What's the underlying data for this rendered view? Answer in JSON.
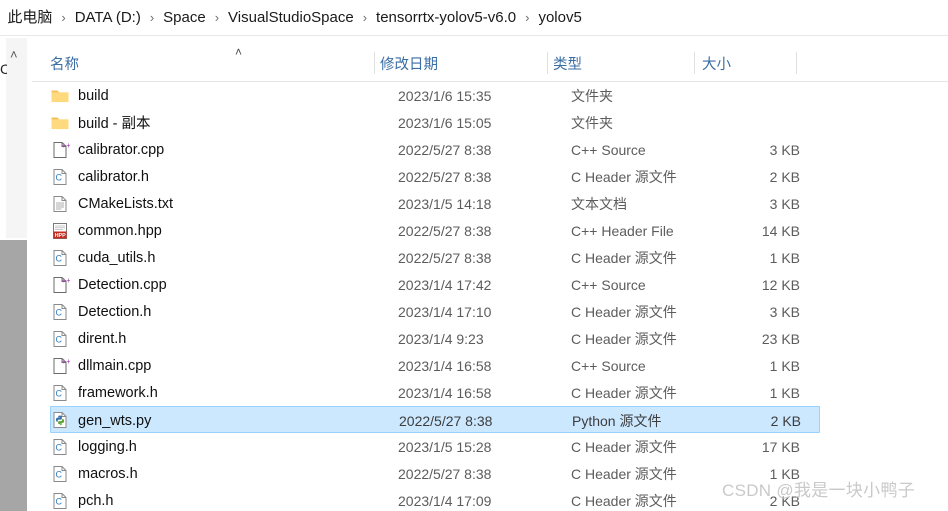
{
  "breadcrumb": {
    "lead_separator": "›",
    "separator": "›",
    "items": [
      {
        "label": "此电脑"
      },
      {
        "label": "DATA (D:)"
      },
      {
        "label": "Space"
      },
      {
        "label": "VisualStudioSpace"
      },
      {
        "label": "tensorrtx-yolov5-v6.0"
      },
      {
        "label": "yolov5"
      }
    ]
  },
  "nav_pane": {
    "collapse_caret": "˄",
    "clipped_label": "C"
  },
  "columns": {
    "sort_indicator": "˄",
    "headers": [
      {
        "label": "名称"
      },
      {
        "label": "修改日期"
      },
      {
        "label": "类型"
      },
      {
        "label": "大小"
      }
    ]
  },
  "files": [
    {
      "name": "build",
      "date": "2023/1/6 15:35",
      "type": "文件夹",
      "size": "",
      "icon": "folder-icon",
      "selected": false
    },
    {
      "name": "build - 副本",
      "date": "2023/1/6 15:05",
      "type": "文件夹",
      "size": "",
      "icon": "folder-icon",
      "selected": false
    },
    {
      "name": "calibrator.cpp",
      "date": "2022/5/27 8:38",
      "type": "C++ Source",
      "size": "3 KB",
      "icon": "cpp-source-icon",
      "selected": false
    },
    {
      "name": "calibrator.h",
      "date": "2022/5/27 8:38",
      "type": "C Header 源文件",
      "size": "2 KB",
      "icon": "c-header-icon",
      "selected": false
    },
    {
      "name": "CMakeLists.txt",
      "date": "2023/1/5 14:18",
      "type": "文本文档",
      "size": "3 KB",
      "icon": "text-file-icon",
      "selected": false
    },
    {
      "name": "common.hpp",
      "date": "2022/5/27 8:38",
      "type": "C++ Header File",
      "size": "14 KB",
      "icon": "hpp-header-icon",
      "selected": false
    },
    {
      "name": "cuda_utils.h",
      "date": "2022/5/27 8:38",
      "type": "C Header 源文件",
      "size": "1 KB",
      "icon": "c-header-icon",
      "selected": false
    },
    {
      "name": "Detection.cpp",
      "date": "2023/1/4 17:42",
      "type": "C++ Source",
      "size": "12 KB",
      "icon": "cpp-source-icon",
      "selected": false
    },
    {
      "name": "Detection.h",
      "date": "2023/1/4 17:10",
      "type": "C Header 源文件",
      "size": "3 KB",
      "icon": "c-header-icon",
      "selected": false
    },
    {
      "name": "dirent.h",
      "date": "2023/1/4 9:23",
      "type": "C Header 源文件",
      "size": "23 KB",
      "icon": "c-header-icon",
      "selected": false
    },
    {
      "name": "dllmain.cpp",
      "date": "2023/1/4 16:58",
      "type": "C++ Source",
      "size": "1 KB",
      "icon": "cpp-source-icon",
      "selected": false
    },
    {
      "name": "framework.h",
      "date": "2023/1/4 16:58",
      "type": "C Header 源文件",
      "size": "1 KB",
      "icon": "c-header-icon",
      "selected": false
    },
    {
      "name": "gen_wts.py",
      "date": "2022/5/27 8:38",
      "type": "Python 源文件",
      "size": "2 KB",
      "icon": "python-file-icon",
      "selected": true
    },
    {
      "name": "logging.h",
      "date": "2023/1/5 15:28",
      "type": "C Header 源文件",
      "size": "17 KB",
      "icon": "c-header-icon",
      "selected": false
    },
    {
      "name": "macros.h",
      "date": "2022/5/27 8:38",
      "type": "C Header 源文件",
      "size": "1 KB",
      "icon": "c-header-icon",
      "selected": false
    },
    {
      "name": "pch.h",
      "date": "2023/1/4 17:09",
      "type": "C Header 源文件",
      "size": "2 KB",
      "icon": "c-header-icon",
      "selected": false
    }
  ],
  "watermark": {
    "text": "CSDN @我是一块小鸭子"
  },
  "colors": {
    "selection_fill": "#cce8ff",
    "selection_border": "#99d1ff",
    "header_text": "#3a6ea5",
    "body_text": "#101010",
    "secondary_text": "#5c5c5c",
    "folder_icon": "#ffd075",
    "scrollbar_thumb": "#a6a6a6"
  }
}
